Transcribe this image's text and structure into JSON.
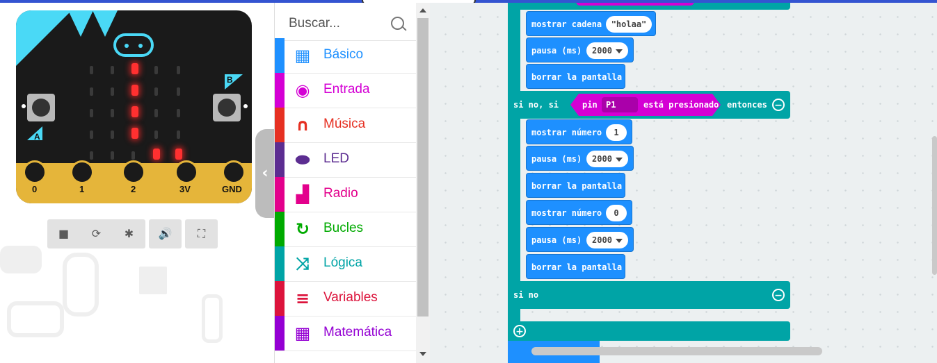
{
  "simulator": {
    "buttons": [
      "A",
      "B"
    ],
    "pins": [
      "0",
      "1",
      "2",
      "3V",
      "GND"
    ],
    "controls": [
      {
        "name": "stop-icon",
        "glyph": "■"
      },
      {
        "name": "restart-icon",
        "glyph": "⟳"
      },
      {
        "name": "debug-icon",
        "glyph": "✱"
      },
      {
        "name": "audio-icon",
        "glyph": "🔊"
      },
      {
        "name": "fullscreen-icon",
        "glyph": "⛶"
      }
    ],
    "collapse_glyph": "‹"
  },
  "toolbox": {
    "search_placeholder": "Buscar...",
    "categories": [
      {
        "label": "Básico",
        "color": "#1e90ff",
        "icon": "grid-icon",
        "glyph": "▦"
      },
      {
        "label": "Entrada",
        "color": "#d400d4",
        "icon": "target-icon",
        "glyph": "◉"
      },
      {
        "label": "Música",
        "color": "#e63022",
        "icon": "headphones-icon",
        "glyph": "∩"
      },
      {
        "label": "LED",
        "color": "#5c2d91",
        "icon": "toggle-icon",
        "glyph": "⬬"
      },
      {
        "label": "Radio",
        "color": "#e3008c",
        "icon": "signal-icon",
        "glyph": "▟"
      },
      {
        "label": "Bucles",
        "color": "#00aa00",
        "icon": "loop-icon",
        "glyph": "↻"
      },
      {
        "label": "Lógica",
        "color": "#00a4a6",
        "icon": "shuffle-icon",
        "glyph": "⤨"
      },
      {
        "label": "Variables",
        "color": "#dc143c",
        "icon": "list-icon",
        "glyph": "≡"
      },
      {
        "label": "Matemática",
        "color": "#9400d3",
        "icon": "calculator-icon",
        "glyph": "▦"
      }
    ]
  },
  "workspace": {
    "blocks": {
      "show_string": "mostrar cadena",
      "string_value": "\"holaa\"",
      "pause": "pausa (ms)",
      "pause_value": "2000",
      "clear": "borrar la pantalla",
      "else_if": "si no, si",
      "pin_label": "pin",
      "pin_value": "P1",
      "pressed": "está presionado",
      "then": "entonces",
      "show_number": "mostrar número",
      "num1": "1",
      "num0": "0",
      "else": "si no"
    }
  }
}
